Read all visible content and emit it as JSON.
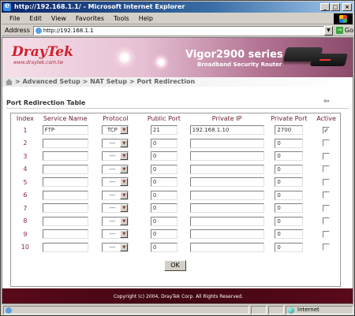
{
  "window": {
    "title": "http://192.168.1.1/ - Microsoft Internet Explorer"
  },
  "menu": [
    "File",
    "Edit",
    "View",
    "Favorites",
    "Tools",
    "Help"
  ],
  "address": {
    "label": "Address",
    "url": "http://192.168.1.1",
    "go_label": "Go"
  },
  "banner": {
    "logo": "DrayTek",
    "logo_url": "www.draytek.com.tw",
    "product": "Vigor2900 series",
    "product_sub": "Broadband Security Router"
  },
  "breadcrumb": "> Advanced Setup > NAT Setup > Port Redirection",
  "section_title": "Port Redirection Table",
  "table": {
    "headers": [
      "Index",
      "Service Name",
      "Protocol",
      "Public Port",
      "Private IP",
      "Private Port",
      "Active"
    ],
    "rows": [
      {
        "index": "1",
        "service": "FTP",
        "protocol": "TCP",
        "public_port": "21",
        "private_ip": "192.168.1.10",
        "private_port": "2700",
        "active": true
      },
      {
        "index": "2",
        "service": "",
        "protocol": "---",
        "public_port": "0",
        "private_ip": "",
        "private_port": "0",
        "active": false
      },
      {
        "index": "3",
        "service": "",
        "protocol": "---",
        "public_port": "0",
        "private_ip": "",
        "private_port": "0",
        "active": false
      },
      {
        "index": "4",
        "service": "",
        "protocol": "---",
        "public_port": "0",
        "private_ip": "",
        "private_port": "0",
        "active": false
      },
      {
        "index": "5",
        "service": "",
        "protocol": "---",
        "public_port": "0",
        "private_ip": "",
        "private_port": "0",
        "active": false
      },
      {
        "index": "6",
        "service": "",
        "protocol": "---",
        "public_port": "0",
        "private_ip": "",
        "private_port": "0",
        "active": false
      },
      {
        "index": "7",
        "service": "",
        "protocol": "---",
        "public_port": "0",
        "private_ip": "",
        "private_port": "0",
        "active": false
      },
      {
        "index": "8",
        "service": "",
        "protocol": "---",
        "public_port": "0",
        "private_ip": "",
        "private_port": "0",
        "active": false
      },
      {
        "index": "9",
        "service": "",
        "protocol": "---",
        "public_port": "0",
        "private_ip": "",
        "private_port": "0",
        "active": false
      },
      {
        "index": "10",
        "service": "",
        "protocol": "---",
        "public_port": "0",
        "private_ip": "",
        "private_port": "0",
        "active": false
      }
    ]
  },
  "ok_label": "OK",
  "footer": "Copyright (c) 2004, DrayTek Corp. All Rights Reserved.",
  "status": {
    "zone": "Internet"
  },
  "colors": {
    "header_text": "#6b2030",
    "index_text": "#8a2a3a",
    "footer_bg": "#400510",
    "logo_red": "#d21e2a"
  }
}
